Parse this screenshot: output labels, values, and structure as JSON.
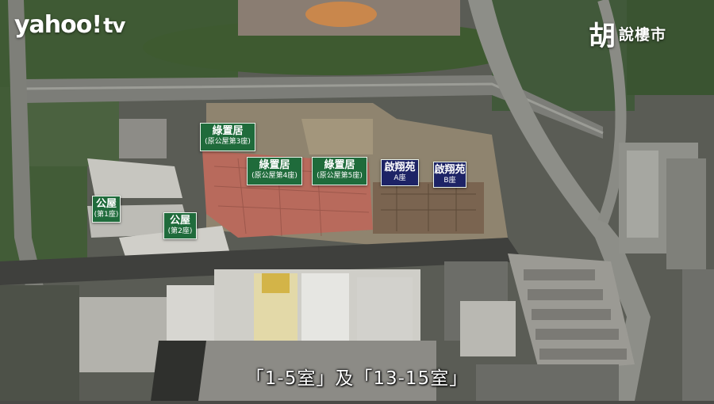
{
  "branding": {
    "yahoo_logo": "yahoo!",
    "yahoo_tv": "tv",
    "brand_glyph": "胡",
    "brand_text": "說樓市"
  },
  "tags": {
    "lvzhiju_3": {
      "title": "綠置居",
      "sub": "(原公屋第3座)"
    },
    "lvzhiju_4": {
      "title": "綠置居",
      "sub": "(原公屋第4座)"
    },
    "lvzhiju_5": {
      "title": "綠置居",
      "sub": "(原公屋第5座)"
    },
    "oxiangyuan_a": {
      "title": "啟翔苑",
      "sub": "A座"
    },
    "oxiangyuan_b": {
      "title": "啟翔苑",
      "sub": "B座"
    },
    "gongwu_1": {
      "title": "公屋",
      "sub": "(第1座)"
    },
    "gongwu_2": {
      "title": "公屋",
      "sub": "(第2座)"
    }
  },
  "subtitle": "「1-5室」及「13-15室」",
  "colors": {
    "tag_green": "#1f6b3b",
    "tag_navy": "#1d2366",
    "site_red": "#b86a5c"
  }
}
